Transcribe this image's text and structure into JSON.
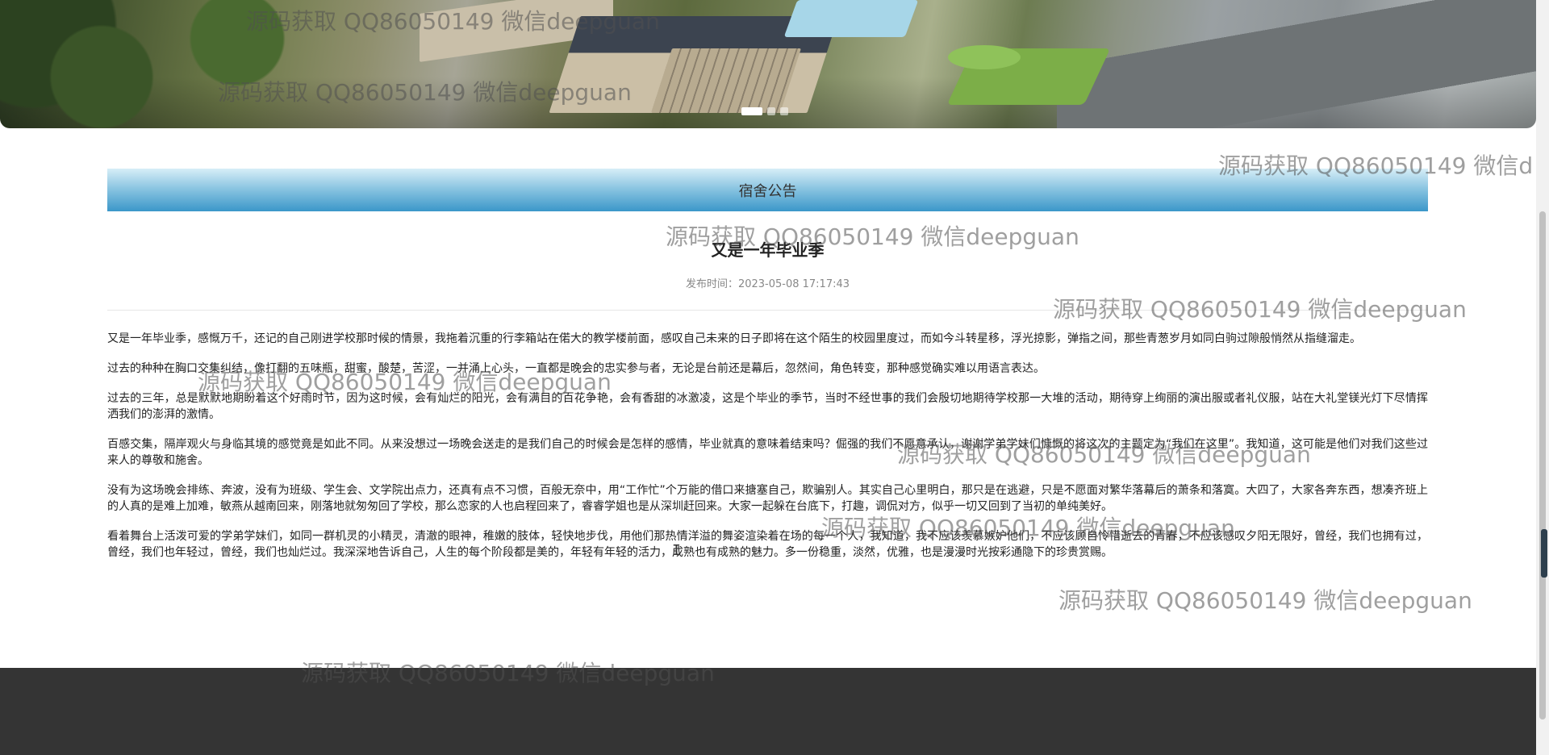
{
  "banner": {
    "slides": [
      {
        "label": "slide-1",
        "active": true
      },
      {
        "label": "slide-2",
        "active": false
      },
      {
        "label": "slide-3",
        "active": false
      }
    ]
  },
  "notice": {
    "section_title": "宿舍公告",
    "article": {
      "title": "又是一年毕业季",
      "publish_time": "发布时间：2023-05-08 17:17:43",
      "paragraphs": [
        "又是一年毕业季，感慨万千，还记的自己刚进学校那时候的情景，我拖着沉重的行李箱站在偌大的教学楼前面，感叹自己未来的日子即将在这个陌生的校园里度过，而如今斗转星移，浮光掠影，弹指之间，那些青葱岁月如同白驹过隙般悄然从指缝溜走。",
        "过去的种种在胸口交集纠结，像打翻的五味瓶，甜蜜，酸楚，苦涩，一并涌上心头，一直都是晚会的忠实参与者，无论是台前还是幕后，忽然间，角色转变，那种感觉确实难以用语言表达。",
        "过去的三年，总是默默地期盼着这个好雨时节，因为这时候，会有灿烂的阳光，会有满目的百花争艳，会有香甜的冰激凌，这是个毕业的季节，当时不经世事的我们会殷切地期待学校那一大堆的活动，期待穿上绚丽的演出服或者礼仪服，站在大礼堂镁光灯下尽情挥洒我们的澎湃的激情。",
        "百感交集，隔岸观火与身临其境的感觉竟是如此不同。从来没想过一场晚会送走的是我们自己的时候会是怎样的感情，毕业就真的意味着结束吗？倔强的我们不愿意承认，谢谢学弟学妹们慷慨的将这次的主题定为“我们在这里”。我知道，这可能是他们对我们这些过来人的尊敬和施舍。",
        "没有为这场晚会排练、奔波，没有为班级、学生会、文学院出点力，还真有点不习惯，百般无奈中，用“工作忙”个万能的借口来搪塞自己，欺骗别人。其实自己心里明白，那只是在逃避，只是不愿面对繁华落幕后的萧条和落寞。大四了，大家各奔东西，想凑齐班上的人真的是难上加难，敏燕从越南回来，刚落地就匆匆回了学校，那么恋家的人也启程回来了，睿睿学姐也是从深圳赶回来。大家一起躲在台底下，打趣，调侃对方，似乎一切又回到了当初的单纯美好。",
        "看着舞台上活泼可爱的学弟学妹们，如同一群机灵的小精灵，清澈的眼神，稚嫩的肢体，轻快地步伐，用他们那热情洋溢的舞姿渲染着在场的每一个人，我知道，我不应该羡慕嫉妒他们，不应该顾自怜惜逝去的青春，不应该感叹夕阳无限好，曾经，我们也拥有过，曾经，我们也年轻过，曾经，我们也灿烂过。我深深地告诉自己，人生的每个阶段都是美的，年轻有年轻的活力，成熟也有成熟的魅力。多一份稳重，淡然，优雅，也是漫漫时光按彩通隐下的珍贵赏赐。"
      ]
    }
  },
  "watermark_text": "源码获取 QQ86050149 微信deepguan",
  "watermark_text_cut": "源码获取 QQ86050149 微信d",
  "cursor_glyph": "I"
}
